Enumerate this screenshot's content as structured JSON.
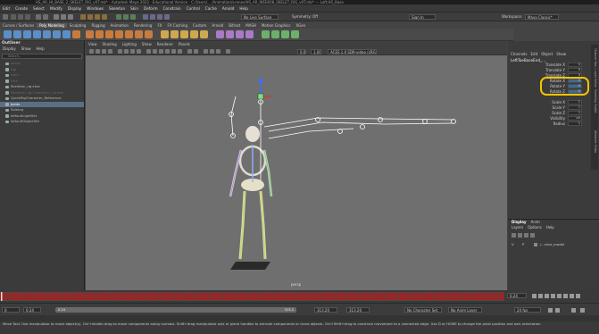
{
  "window": {
    "title": "HS_AR_HI_BASE_2_SKELET_RIG_v0T.mb* - Autodesk Maya 2022 · Educational Version · C:/Users/... /Animation/scenes/HS_AR_WEEK08_SKELET_RIG_v0T.mb* --- Left:HS_Base"
  },
  "menubar": {
    "items": [
      "Edit",
      "Create",
      "Select",
      "Modify",
      "Display",
      "Windows",
      "Skeleton",
      "Skin",
      "Deform",
      "Constrain",
      "Control",
      "Cache",
      "Arnold",
      "Help"
    ]
  },
  "statusline": {
    "live_surface": "No Live Surface",
    "symmetry": "Symmetry: Off",
    "sign_in": "Sign In",
    "workspace_label": "Workspace:",
    "workspace": "Maya Classic*"
  },
  "shelf": {
    "tabs": [
      "Curves / Surfaces",
      "Poly Modeling",
      "Sculpting",
      "Rigging",
      "Animation",
      "Rendering",
      "FX",
      "FX Caching",
      "Custom",
      "Arnold",
      "Bifrost",
      "MASH",
      "Motion Graphics",
      "XGen"
    ],
    "active_tab": "Poly Modeling"
  },
  "outliner": {
    "title": "Outliner",
    "menu": [
      "Display",
      "Show",
      "Help"
    ],
    "search_placeholder": "Search...",
    "items": [
      {
        "label": "persp",
        "state": "dim"
      },
      {
        "label": "top",
        "state": "dim"
      },
      {
        "label": "front",
        "state": "dim"
      },
      {
        "label": "side",
        "state": "dim"
      },
      {
        "label": "Skeleton_rig:char",
        "state": "normal"
      },
      {
        "label": "Skeleton_rig:Character_Control",
        "state": "dim"
      },
      {
        "label": "QuickRigCharacter_Reference",
        "state": "normal"
      },
      {
        "label": "Joints",
        "state": "selected"
      },
      {
        "label": "Soleing",
        "state": "normal"
      },
      {
        "label": "defaultLightSet",
        "state": "normal"
      },
      {
        "label": "defaultObjectSet",
        "state": "normal"
      }
    ]
  },
  "viewport": {
    "menu": [
      "View",
      "Shading",
      "Lighting",
      "Show",
      "Renderer",
      "Panels"
    ],
    "field_a": "0.00",
    "field_b": "1.00",
    "color_space": "ACES 1.0 SDR-video (sRGB)",
    "camera_label": "persp"
  },
  "channelbox": {
    "menu": [
      "Channels",
      "Edit",
      "Object",
      "Show"
    ],
    "node_name": "LeftToeBaseEnd_...",
    "attributes": [
      {
        "label": "Translate X",
        "value": "0"
      },
      {
        "label": "Translate Y",
        "value": "0"
      },
      {
        "label": "Translate Z",
        "value": "0"
      },
      {
        "label": "Rotate X",
        "value": "0"
      },
      {
        "label": "Rotate Y",
        "value": "0"
      },
      {
        "label": "Rotate Z",
        "value": "0"
      },
      {
        "label": "Scale X",
        "value": "1"
      },
      {
        "label": "Scale Y",
        "value": "1"
      },
      {
        "label": "Scale Z",
        "value": "1"
      },
      {
        "label": "Visibility",
        "value": "on"
      },
      {
        "label": "Radius",
        "value": "1"
      }
    ],
    "side_tabs": [
      "Channel Box / Layer Editor",
      "Modeling Toolkit",
      "Attribute Editor"
    ]
  },
  "layers": {
    "tabs": [
      "Display",
      "Anim"
    ],
    "active_tab": "Display",
    "menu": [
      "Layers",
      "Options",
      "Help"
    ],
    "layer_v": "V",
    "layer_p": "P",
    "layer_name": "/...char_model"
  },
  "timeline": {
    "current_frame": "0.24"
  },
  "range": {
    "start": "0",
    "inner_start": "0.24",
    "inner_start2": "0.24",
    "end": "313.2",
    "end2": "313.20",
    "end3": "313.20",
    "character_set": "No Character Set",
    "anim_layer": "No Anim Layer",
    "fps": "24 fps"
  },
  "help": {
    "text": "Move Tool: Use manipulator to move object(s). Ctrl+middle-drag to move components along normals. Shift+drag manipulator axis or plane handles to extrude components or clone objects. Ctrl+Shift+drag to constrain movement to a connected edge. Use D or HOME to change the pivot position and axis orientation."
  },
  "colors": {
    "highlight": "#f5c400",
    "timeline_red": "#cc1010",
    "selection": "#5a6f86",
    "viewport_bg": "#6f6f6f"
  }
}
